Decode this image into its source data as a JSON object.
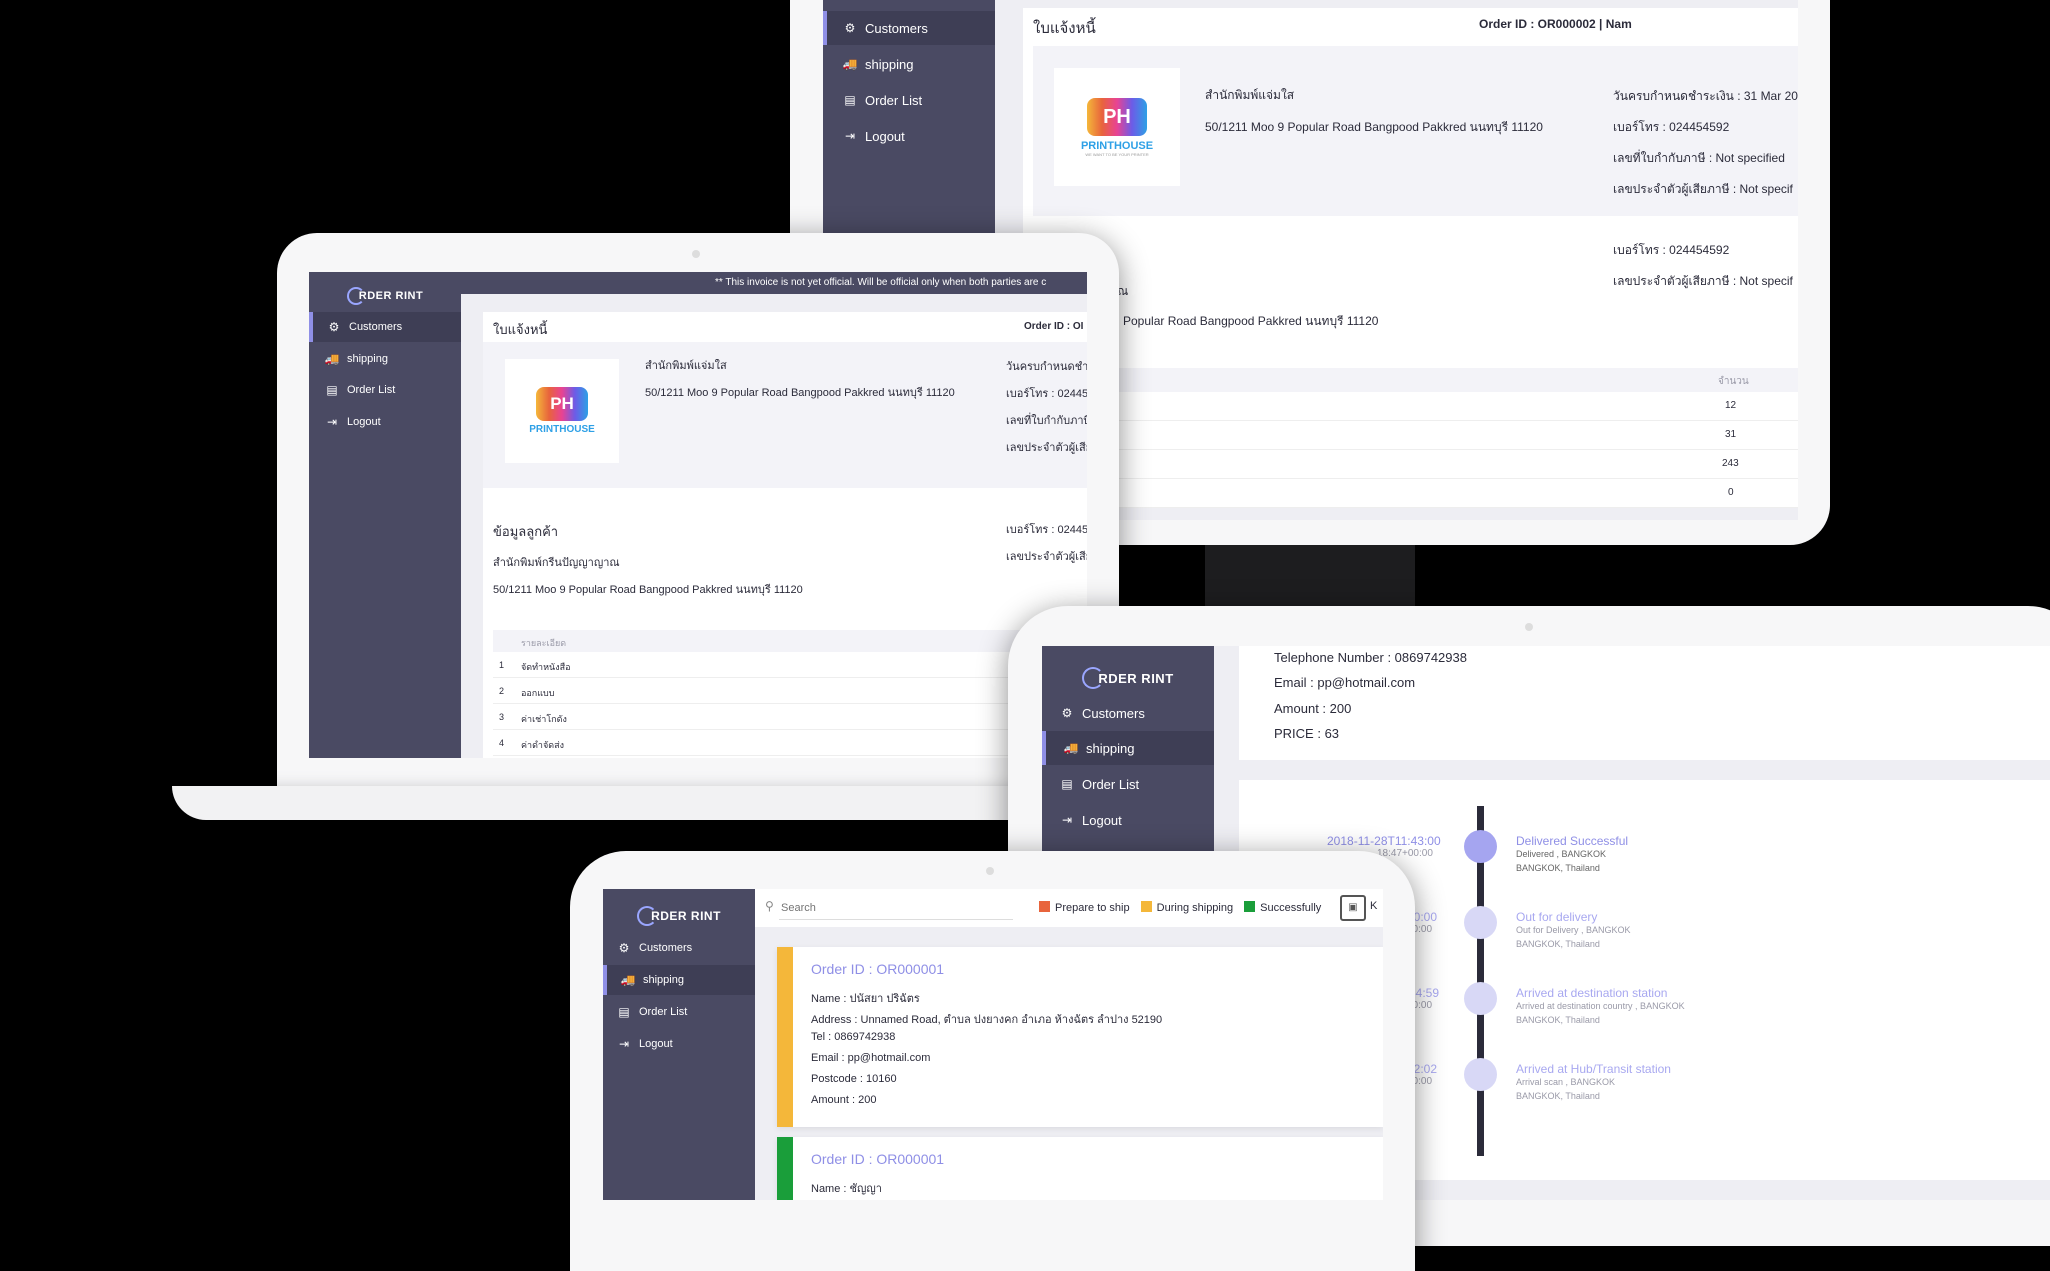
{
  "brand": {
    "logo_text": "RDER RINT",
    "printhouse": "PRINTHOUSE",
    "printhouse_tagline": "WE WANT TO BE YOUR PRINTER"
  },
  "nav": {
    "customers": "Customers",
    "shipping": "shipping",
    "order_list": "Order List",
    "logout": "Logout"
  },
  "invoice": {
    "title": "ใบแจ้งหนี้",
    "order_header": "Order ID : OR000002 | Nam",
    "order_header_short": "Order ID : OI",
    "notice": "** This invoice is not yet official. Will be official only when both parties are c",
    "company_name": "สำนักพิมพ์แจ่มใส",
    "company_address": "50/1211 Moo 9 Popular Road Bangpood Pakkred นนทบุรี 11120",
    "due_date": "วันครบกำหนดชำระเงิน : 31 Mar 20",
    "due_date_short": "วันครบกำหนดชำระ",
    "phone": "เบอร์โทร : 024454592",
    "phone_short": "เบอร์โทร : 02445",
    "tax_invoice": "เลขที่ใบกำกับภาษี : Not specified",
    "tax_invoice_short": "เลขที่ใบกำกับภาษี",
    "tax_id": "เลขประจำตัวผู้เสียภาษี : Not specif",
    "tax_id_short": "เลขประจำตัวผู้เสีย",
    "customer_heading": "ข้อมูลลูกค้า",
    "customer_name": "สำนักพิมพ์กรีนปัญญาญาณ",
    "customer_name_partial": "ญญาญาณ",
    "customer_address": "50/1211 Moo 9 Popular Road Bangpood Pakkred นนทบุรี 11120",
    "customer_address_partial": "Popular Road Bangpood Pakkred นนทบุรี 11120",
    "customer_phone": "เบอร์โทร : 024454592",
    "customer_tax_id": "เลขประจำตัวผู้เสียภาษี : Not specif",
    "table": {
      "col_detail": "รายละเอียด",
      "col_qty": "จำนวน",
      "rows": [
        {
          "no": "1",
          "detail": "จัดทำหนังสือ",
          "qty": "12"
        },
        {
          "no": "2",
          "detail": "ออกแบบ",
          "qty": "31"
        },
        {
          "no": "3",
          "detail": "ค่าเช่าโกดัง",
          "qty": "243"
        },
        {
          "no": "4",
          "detail": "ค่าดำจัดส่ง",
          "qty": "0"
        }
      ]
    }
  },
  "shipping_detail": {
    "telephone": "Telephone Number : 0869742938",
    "email": "Email : pp@hotmail.com",
    "amount": "Amount : 200",
    "price": "PRICE : 63",
    "timeline": [
      {
        "time": "2018-11-28T11:43:00",
        "time2": "18:47+00:00",
        "title": "Delivered Successful",
        "line1": "Delivered , BANGKOK",
        "line2": "BANGKOK, Thailand"
      },
      {
        "time": "00:00",
        "time2": "00:00",
        "title": "Out for delivery",
        "line1": "Out for Delivery , BANGKOK",
        "line2": "BANGKOK, Thailand"
      },
      {
        "time": "54:59",
        "time2": "00:00",
        "title": "Arrived at destination station",
        "line1": "Arrived at destination country , BANGKOK",
        "line2": "BANGKOK, Thailand"
      },
      {
        "time": "52:02",
        "time2": "00:00",
        "title": "Arrived at Hub/Transit station",
        "line1": "Arrival scan , BANGKOK",
        "line2": "BANGKOK, Thailand"
      }
    ]
  },
  "shipping_list": {
    "search_placeholder": "Search",
    "legend": [
      {
        "label": "Prepare to ship",
        "color": "#e8643c"
      },
      {
        "label": "During shipping",
        "color": "#f4b73a"
      },
      {
        "label": "Successfully",
        "color": "#1a9e3a"
      }
    ],
    "legend_extra": "K",
    "orders": [
      {
        "id": "Order ID : OR000001",
        "name": "Name : ปนัสยา ปริฉัตร",
        "address": "Address : Unnamed Road, ตำบล ปงยางคก อำเภอ ห้างฉัตร ลำปาง 52190",
        "tel": "Tel : 0869742938",
        "email": "Email : pp@hotmail.com",
        "postcode": "Postcode : 10160",
        "amount": "Amount : 200",
        "color": "#f4b73a"
      },
      {
        "id": "Order ID : OR000001",
        "name": "Name : ชัญญา",
        "color": "#1a9e3a"
      }
    ]
  }
}
